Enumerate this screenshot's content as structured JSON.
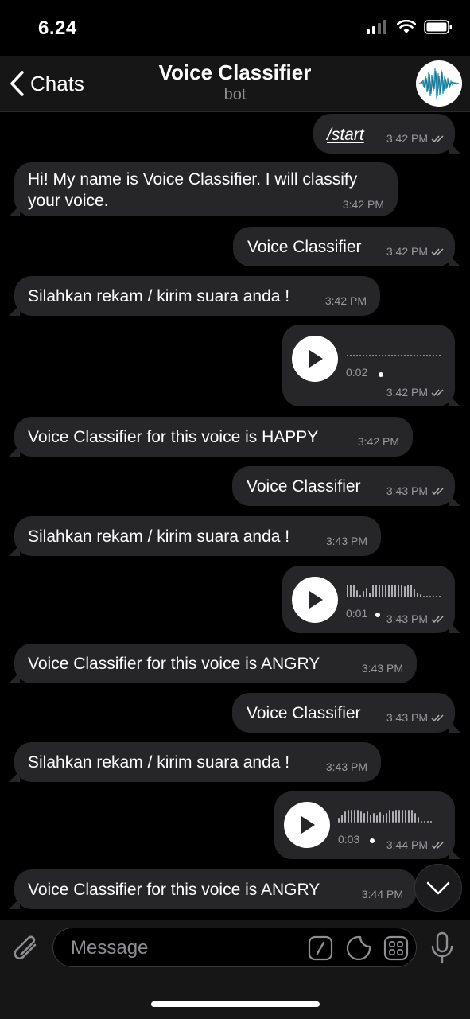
{
  "status_bar": {
    "time": "6.24"
  },
  "header": {
    "back_label": "Chats",
    "title": "Voice Classifier",
    "subtitle": "bot"
  },
  "messages": [
    {
      "dir": "out",
      "type": "text",
      "text": "/start",
      "time": "3:42 PM",
      "read": true
    },
    {
      "dir": "in",
      "type": "text",
      "text": "Hi! My name is Voice Classifier. I will classify your voice.",
      "time": "3:42 PM"
    },
    {
      "dir": "out",
      "type": "text",
      "text": "Voice Classifier",
      "time": "3:42 PM",
      "read": true
    },
    {
      "dir": "in",
      "type": "text",
      "text": "Silahkan rekam / kirim suara anda !",
      "time": "3:42 PM"
    },
    {
      "dir": "out",
      "type": "voice",
      "duration": "0:02",
      "time": "3:42 PM",
      "read": true
    },
    {
      "dir": "in",
      "type": "text",
      "text": "Voice Classifier for this voice is HAPPY",
      "time": "3:42 PM"
    },
    {
      "dir": "out",
      "type": "text",
      "text": "Voice Classifier",
      "time": "3:43 PM",
      "read": true
    },
    {
      "dir": "in",
      "type": "text",
      "text": "Silahkan rekam / kirim suara anda !",
      "time": "3:43 PM"
    },
    {
      "dir": "out",
      "type": "voice",
      "duration": "0:01",
      "time": "3:43 PM",
      "read": true
    },
    {
      "dir": "in",
      "type": "text",
      "text": "Voice Classifier for this voice is ANGRY",
      "time": "3:43 PM"
    },
    {
      "dir": "out",
      "type": "text",
      "text": "Voice Classifier",
      "time": "3:43 PM",
      "read": true
    },
    {
      "dir": "in",
      "type": "text",
      "text": "Silahkan rekam / kirim suara anda !",
      "time": "3:43 PM"
    },
    {
      "dir": "out",
      "type": "voice",
      "duration": "0:03",
      "time": "3:44 PM",
      "read": true
    },
    {
      "dir": "in",
      "type": "text",
      "text": "Voice Classifier for this voice is ANGRY",
      "time": "3:44 PM"
    }
  ],
  "input": {
    "placeholder": "Message"
  },
  "icons": {
    "back": "chevron-left-icon",
    "attach": "paperclip-icon",
    "commands": "slash-command-icon",
    "sticker": "sticker-icon",
    "keyboard": "bot-keyboard-icon",
    "mic": "microphone-icon",
    "scroll": "chevron-down-icon",
    "read": "double-check-icon"
  },
  "colors": {
    "background": "#000000",
    "bubble": "#262628",
    "bar": "#161616",
    "text": "#ffffff",
    "muted": "#8e8e93"
  }
}
